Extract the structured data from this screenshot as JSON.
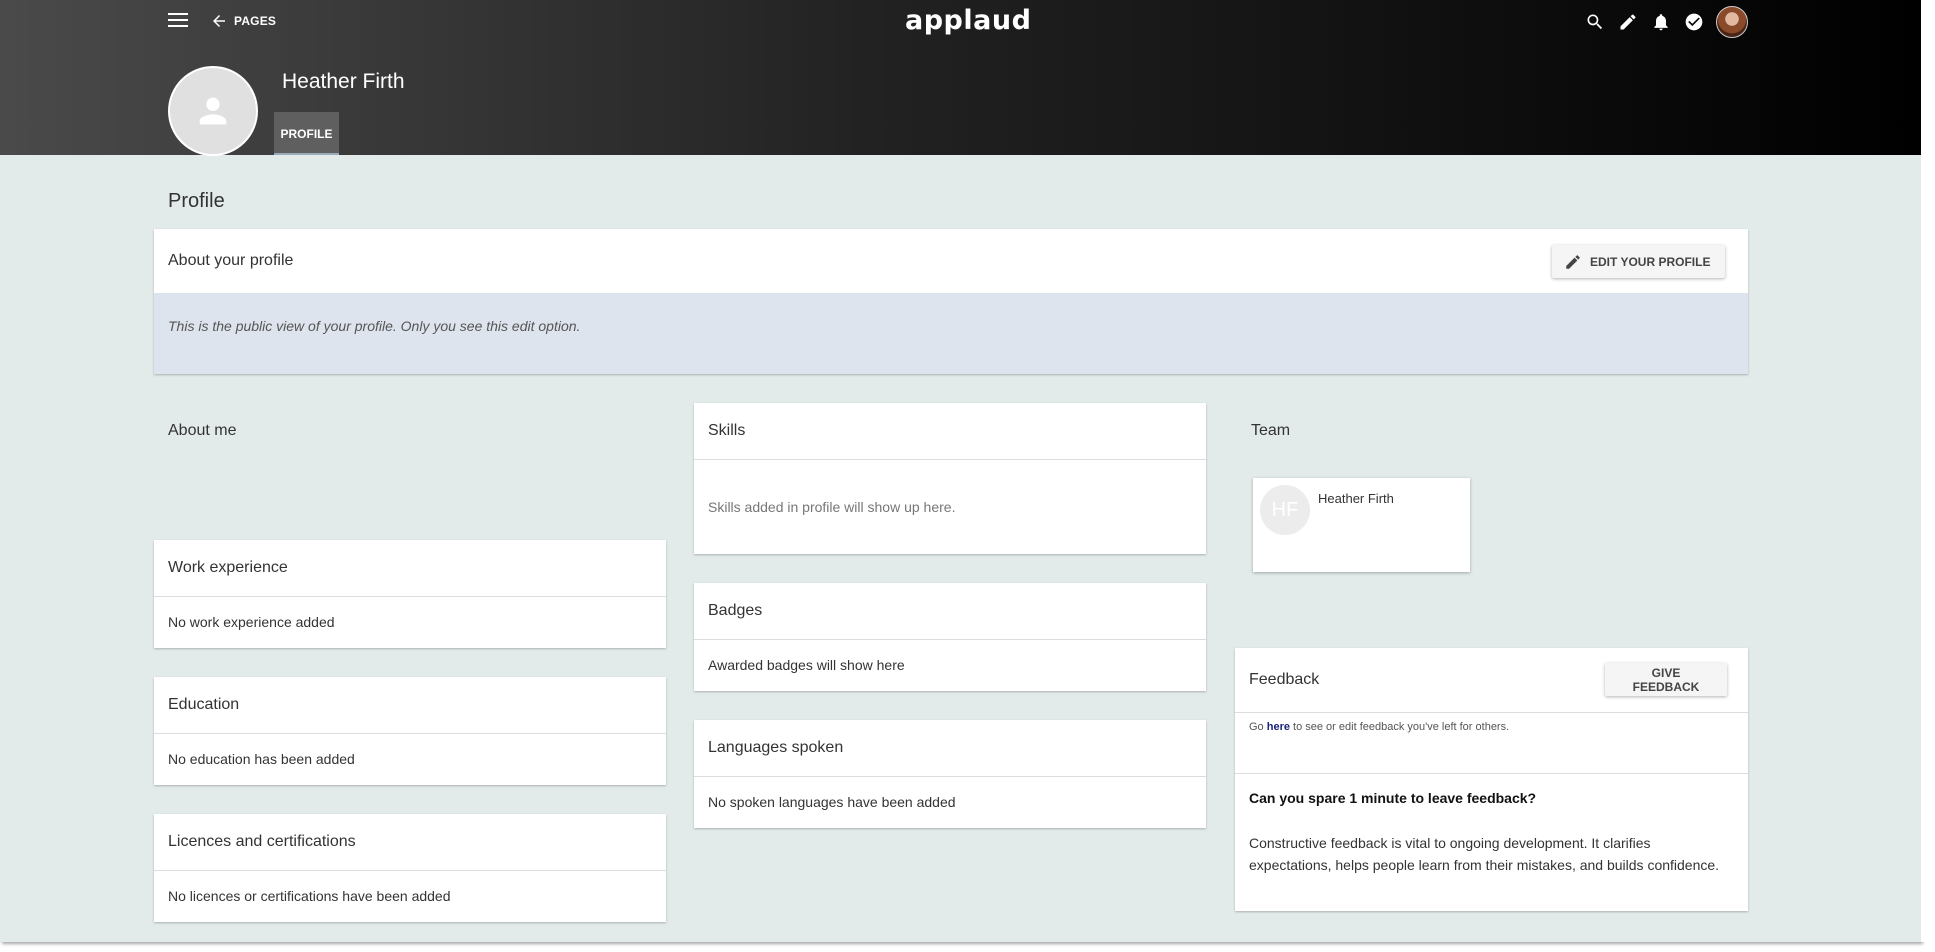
{
  "header": {
    "back_label": "PAGES",
    "logo": "applaud",
    "profile_name": "Heather Firth",
    "profile_tab": "PROFILE"
  },
  "page_title": "Profile",
  "about_profile": {
    "title": "About your profile",
    "edit_button": "EDIT YOUR PROFILE",
    "info": "This is the public view of your profile. Only you see this edit option."
  },
  "about_me": {
    "title": "About me"
  },
  "work_experience": {
    "title": "Work experience",
    "body": "No work experience added"
  },
  "education": {
    "title": "Education",
    "body": "No education has been added"
  },
  "licences": {
    "title": "Licences and certifications",
    "body": "No licences or certifications have been added"
  },
  "skills": {
    "title": "Skills",
    "body": "Skills added in profile will show up here."
  },
  "badges": {
    "title": "Badges",
    "body": "Awarded badges will show here"
  },
  "languages": {
    "title": "Languages spoken",
    "body": "No spoken languages have been added"
  },
  "team": {
    "title": "Team",
    "member": {
      "initials": "HF",
      "name": "Heather Firth"
    }
  },
  "feedback": {
    "title": "Feedback",
    "button": "GIVE FEEDBACK",
    "link_prefix": "Go ",
    "link_text": "here",
    "link_suffix": " to see or edit feedback you've left for others.",
    "question": "Can you spare 1 minute to leave feedback?",
    "text": "Constructive feedback is vital to ongoing development. It clarifies expectations, helps people learn from their mistakes, and builds confidence."
  }
}
